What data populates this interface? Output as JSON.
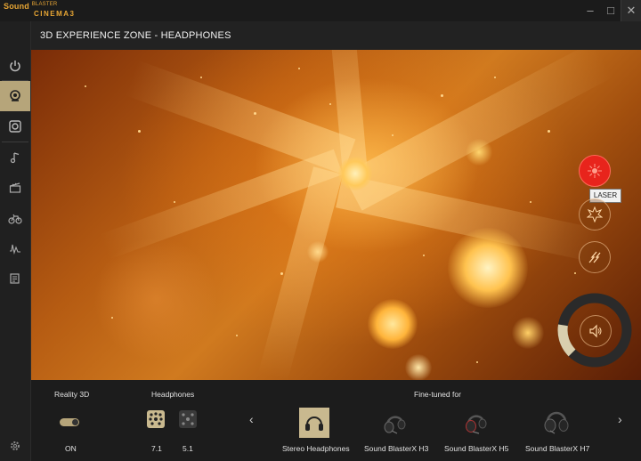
{
  "app": {
    "logo_line1": "Sound",
    "logo_line1_small": "BLASTER",
    "logo_line2": "CINEMA3",
    "brand_color": "#e8a634",
    "accent_color": "#b6a57a",
    "window_controls": [
      "minimize",
      "maximize",
      "close"
    ]
  },
  "sidebar": {
    "items": [
      {
        "icon": "power-icon",
        "active": false
      },
      {
        "icon": "3d-experience-icon",
        "active": true
      },
      {
        "icon": "speaker-icon",
        "active": false
      },
      {
        "icon": "music-note-icon",
        "active": false
      },
      {
        "icon": "clapperboard-icon",
        "active": false
      },
      {
        "icon": "bike-icon",
        "active": false
      },
      {
        "icon": "waveform-icon",
        "active": false
      },
      {
        "icon": "notes-icon",
        "active": false
      }
    ],
    "footer_icon": "gear-icon"
  },
  "header": {
    "title": "3D EXPERIENCE ZONE - HEADPHONES"
  },
  "effects": {
    "buttons": [
      {
        "name": "laser",
        "icon": "laser-icon",
        "active": true
      },
      {
        "name": "explosion",
        "icon": "explosion-icon",
        "active": false
      },
      {
        "name": "lightning",
        "icon": "lightning-icon",
        "active": false
      }
    ],
    "tooltip": "LASER",
    "volume_icon": "volume-icon",
    "volume_dial_level": 0.2
  },
  "bottom": {
    "reality3d": {
      "label": "Reality 3D",
      "state": "ON",
      "enabled": true
    },
    "headphones": {
      "label": "Headphones",
      "options": [
        {
          "label": "7.1",
          "selected": true
        },
        {
          "label": "5.1",
          "selected": false
        }
      ]
    },
    "finetuned": {
      "label": "Fine-tuned for",
      "devices": [
        {
          "label": "Stereo Headphones",
          "selected": true
        },
        {
          "label": "Sound BlasterX H3",
          "selected": false
        },
        {
          "label": "Sound BlasterX H5",
          "selected": false
        },
        {
          "label": "Sound BlasterX H7",
          "selected": false
        }
      ]
    },
    "prev_arrow": "‹",
    "next_arrow": "›"
  }
}
